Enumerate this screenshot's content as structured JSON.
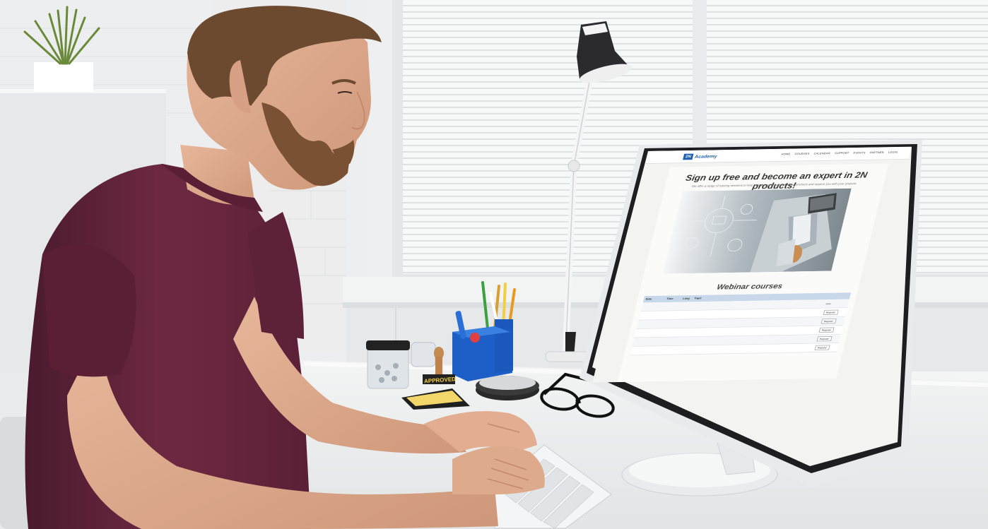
{
  "monitor_page": {
    "logo_badge": "2N",
    "logo_text": "Academy",
    "nav_items": [
      "Home",
      "Courses",
      "Calendar",
      "Support",
      "Events",
      "Partner",
      "Login"
    ],
    "headline": "Sign up free and become an expert in 2N products!",
    "subline": "We offer a range of training sessions to help extend your knowledge of our products and support you with your projects.",
    "section_title": "Webinar courses",
    "table_headers": [
      "Date",
      "Time",
      "Lang",
      "Topic",
      ""
    ],
    "rows": [
      {
        "date": "",
        "time": "",
        "lang": "",
        "topic": "",
        "action": ""
      },
      {
        "date": "",
        "time": "",
        "lang": "",
        "topic": "",
        "action": "Register"
      },
      {
        "date": "",
        "time": "",
        "lang": "",
        "topic": "",
        "action": "Register"
      },
      {
        "date": "",
        "time": "",
        "lang": "",
        "topic": "",
        "action": "Register"
      },
      {
        "date": "",
        "time": "",
        "lang": "",
        "topic": "",
        "action": "Register"
      },
      {
        "date": "",
        "time": "",
        "lang": "",
        "topic": "",
        "action": "Register"
      }
    ]
  },
  "desk_stamp_text": "APPROVED"
}
